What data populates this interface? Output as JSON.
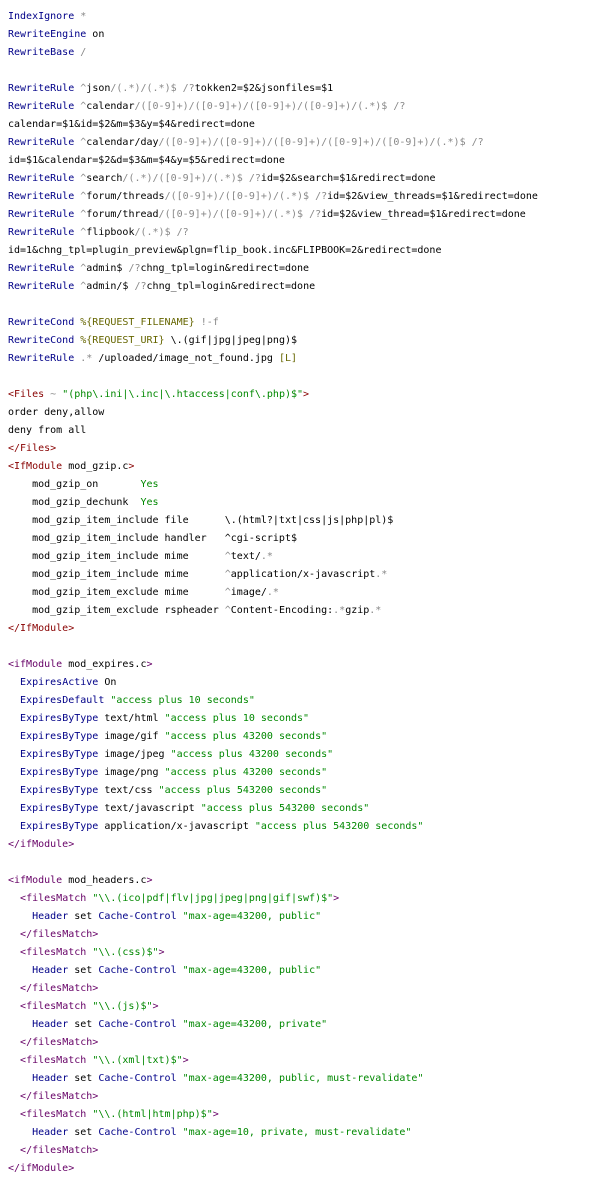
{
  "document": {
    "lines": [
      [
        [
          "k",
          "IndexIgnore"
        ],
        [
          "p",
          " "
        ],
        [
          "g",
          "*"
        ]
      ],
      [
        [
          "k",
          "RewriteEngine"
        ],
        [
          "p",
          " on"
        ]
      ],
      [
        [
          "k",
          "RewriteBase"
        ],
        [
          "p",
          " "
        ],
        [
          "g",
          "/"
        ]
      ],
      [],
      [
        [
          "k",
          "RewriteRule"
        ],
        [
          "p",
          " "
        ],
        [
          "g",
          "^"
        ],
        [
          "p",
          "json"
        ],
        [
          "g",
          "/(.*)/(.*)$"
        ],
        [
          "p",
          " "
        ],
        [
          "g",
          "/?"
        ],
        [
          "p",
          "tokken2=$2&jsonfiles=$1"
        ]
      ],
      [
        [
          "k",
          "RewriteRule"
        ],
        [
          "p",
          " "
        ],
        [
          "g",
          "^"
        ],
        [
          "p",
          "calendar"
        ],
        [
          "g",
          "/([0-9]+)/([0-9]+)/([0-9]+)/([0-9]+)/(.*)$"
        ],
        [
          "p",
          " "
        ],
        [
          "g",
          "/?"
        ]
      ],
      [
        [
          "p",
          "calendar=$1&id=$2&m=$3&y=$4&redirect=done"
        ]
      ],
      [
        [
          "k",
          "RewriteRule"
        ],
        [
          "p",
          " "
        ],
        [
          "g",
          "^"
        ],
        [
          "p",
          "calendar/day"
        ],
        [
          "g",
          "/([0-9]+)/([0-9]+)/([0-9]+)/([0-9]+)/([0-9]+)/(.*)$"
        ],
        [
          "p",
          " "
        ],
        [
          "g",
          "/?"
        ]
      ],
      [
        [
          "p",
          "id=$1&calendar=$2&d=$3&m=$4&y=$5&redirect=done"
        ]
      ],
      [
        [
          "k",
          "RewriteRule"
        ],
        [
          "p",
          " "
        ],
        [
          "g",
          "^"
        ],
        [
          "p",
          "search"
        ],
        [
          "g",
          "/(.*)/([0-9]+)/(.*)$"
        ],
        [
          "p",
          " "
        ],
        [
          "g",
          "/?"
        ],
        [
          "p",
          "id=$2&search=$1&redirect=done"
        ]
      ],
      [
        [
          "k",
          "RewriteRule"
        ],
        [
          "p",
          " "
        ],
        [
          "g",
          "^"
        ],
        [
          "p",
          "forum/threads"
        ],
        [
          "g",
          "/([0-9]+)/([0-9]+)/(.*)$"
        ],
        [
          "p",
          " "
        ],
        [
          "g",
          "/?"
        ],
        [
          "p",
          "id=$2&view_threads=$1&redirect=done"
        ]
      ],
      [
        [
          "k",
          "RewriteRule"
        ],
        [
          "p",
          " "
        ],
        [
          "g",
          "^"
        ],
        [
          "p",
          "forum/thread"
        ],
        [
          "g",
          "/([0-9]+)/([0-9]+)/(.*)$"
        ],
        [
          "p",
          " "
        ],
        [
          "g",
          "/?"
        ],
        [
          "p",
          "id=$2&view_thread=$1&redirect=done"
        ]
      ],
      [
        [
          "k",
          "RewriteRule"
        ],
        [
          "p",
          " "
        ],
        [
          "g",
          "^"
        ],
        [
          "p",
          "flipbook"
        ],
        [
          "g",
          "/(.*)$"
        ],
        [
          "p",
          " "
        ],
        [
          "g",
          "/?"
        ]
      ],
      [
        [
          "p",
          "id=1&chng_tpl=plugin_preview&plgn=flip_book.inc&FLIPBOOK=2&redirect=done"
        ]
      ],
      [
        [
          "k",
          "RewriteRule"
        ],
        [
          "p",
          " "
        ],
        [
          "g",
          "^"
        ],
        [
          "p",
          "admin$"
        ],
        [
          "p",
          " "
        ],
        [
          "g",
          "/?"
        ],
        [
          "p",
          "chng_tpl=login&redirect=done"
        ]
      ],
      [
        [
          "k",
          "RewriteRule"
        ],
        [
          "p",
          " "
        ],
        [
          "g",
          "^"
        ],
        [
          "p",
          "admin/$"
        ],
        [
          "p",
          " "
        ],
        [
          "g",
          "/?"
        ],
        [
          "p",
          "chng_tpl=login&redirect=done"
        ]
      ],
      [],
      [
        [
          "k",
          "RewriteCond"
        ],
        [
          "p",
          " "
        ],
        [
          "a",
          "%{REQUEST_FILENAME}"
        ],
        [
          "p",
          " "
        ],
        [
          "g",
          "!-f"
        ]
      ],
      [
        [
          "k",
          "RewriteCond"
        ],
        [
          "p",
          " "
        ],
        [
          "a",
          "%{REQUEST_URI}"
        ],
        [
          "p",
          " \\.(gif|jpg|jpeg|png)$"
        ]
      ],
      [
        [
          "k",
          "RewriteRule"
        ],
        [
          "p",
          " "
        ],
        [
          "g",
          ".*"
        ],
        [
          "p",
          " /uploaded/image_not_found.jpg "
        ],
        [
          "a",
          "[L]"
        ]
      ],
      [],
      [
        [
          "t",
          "<Files"
        ],
        [
          "p",
          " "
        ],
        [
          "g",
          "~"
        ],
        [
          "p",
          " "
        ],
        [
          "s",
          "\"(php\\.ini|\\.inc|\\.htaccess|conf\\.php)$\""
        ],
        [
          "t",
          ">"
        ]
      ],
      [
        [
          "p",
          "order deny,allow"
        ]
      ],
      [
        [
          "p",
          "deny from all"
        ]
      ],
      [
        [
          "t",
          "</Files>"
        ]
      ],
      [
        [
          "t",
          "<IfModule"
        ],
        [
          "p",
          " mod_gzip.c"
        ],
        [
          "t",
          ">"
        ]
      ],
      [
        [
          "p",
          "    mod_gzip_on       "
        ],
        [
          "s",
          "Yes"
        ]
      ],
      [
        [
          "p",
          "    mod_gzip_dechunk  "
        ],
        [
          "s",
          "Yes"
        ]
      ],
      [
        [
          "p",
          "    mod_gzip_item_include file      \\.(html?|txt|css|js|php|pl)$"
        ]
      ],
      [
        [
          "p",
          "    mod_gzip_item_include handler   ^cgi-script$"
        ]
      ],
      [
        [
          "p",
          "    mod_gzip_item_include mime      "
        ],
        [
          "g",
          "^"
        ],
        [
          "p",
          "text/"
        ],
        [
          "g",
          ".*"
        ]
      ],
      [
        [
          "p",
          "    mod_gzip_item_include mime      "
        ],
        [
          "g",
          "^"
        ],
        [
          "p",
          "application/x-javascript"
        ],
        [
          "g",
          ".*"
        ]
      ],
      [
        [
          "p",
          "    mod_gzip_item_exclude mime      "
        ],
        [
          "g",
          "^"
        ],
        [
          "p",
          "image/"
        ],
        [
          "g",
          ".*"
        ]
      ],
      [
        [
          "p",
          "    mod_gzip_item_exclude rspheader "
        ],
        [
          "g",
          "^"
        ],
        [
          "p",
          "Content-Encoding:"
        ],
        [
          "g",
          ".*"
        ],
        [
          "p",
          "gzip"
        ],
        [
          "g",
          ".*"
        ]
      ],
      [
        [
          "t",
          "</IfModule>"
        ]
      ],
      [],
      [
        [
          "tl",
          "<ifModule"
        ],
        [
          "p",
          " mod_expires.c"
        ],
        [
          "tl",
          ">"
        ]
      ],
      [
        [
          "p",
          "  "
        ],
        [
          "k",
          "ExpiresActive"
        ],
        [
          "p",
          " On"
        ]
      ],
      [
        [
          "p",
          "  "
        ],
        [
          "k",
          "ExpiresDefault"
        ],
        [
          "p",
          " "
        ],
        [
          "s",
          "\"access plus 10 seconds\""
        ]
      ],
      [
        [
          "p",
          "  "
        ],
        [
          "k",
          "ExpiresByType"
        ],
        [
          "p",
          " text/html "
        ],
        [
          "s",
          "\"access plus 10 seconds\""
        ]
      ],
      [
        [
          "p",
          "  "
        ],
        [
          "k",
          "ExpiresByType"
        ],
        [
          "p",
          " image/gif "
        ],
        [
          "s",
          "\"access plus 43200 seconds\""
        ]
      ],
      [
        [
          "p",
          "  "
        ],
        [
          "k",
          "ExpiresByType"
        ],
        [
          "p",
          " image/jpeg "
        ],
        [
          "s",
          "\"access plus 43200 seconds\""
        ]
      ],
      [
        [
          "p",
          "  "
        ],
        [
          "k",
          "ExpiresByType"
        ],
        [
          "p",
          " image/png "
        ],
        [
          "s",
          "\"access plus 43200 seconds\""
        ]
      ],
      [
        [
          "p",
          "  "
        ],
        [
          "k",
          "ExpiresByType"
        ],
        [
          "p",
          " text/css "
        ],
        [
          "s",
          "\"access plus 543200 seconds\""
        ]
      ],
      [
        [
          "p",
          "  "
        ],
        [
          "k",
          "ExpiresByType"
        ],
        [
          "p",
          " text/javascript "
        ],
        [
          "s",
          "\"access plus 543200 seconds\""
        ]
      ],
      [
        [
          "p",
          "  "
        ],
        [
          "k",
          "ExpiresByType"
        ],
        [
          "p",
          " application/x-javascript "
        ],
        [
          "s",
          "\"access plus 543200 seconds\""
        ]
      ],
      [
        [
          "tl",
          "</ifModule>"
        ]
      ],
      [],
      [
        [
          "tl",
          "<ifModule"
        ],
        [
          "p",
          " mod_headers.c"
        ],
        [
          "tl",
          ">"
        ]
      ],
      [
        [
          "p",
          "  "
        ],
        [
          "tl",
          "<filesMatch"
        ],
        [
          "p",
          " "
        ],
        [
          "s",
          "\"\\\\.(ico|pdf|flv|jpg|jpeg|png|gif|swf)$\""
        ],
        [
          "tl",
          ">"
        ]
      ],
      [
        [
          "p",
          "    "
        ],
        [
          "k",
          "Header"
        ],
        [
          "p",
          " set "
        ],
        [
          "k",
          "Cache-Control"
        ],
        [
          "p",
          " "
        ],
        [
          "s",
          "\"max-age=43200, public\""
        ]
      ],
      [
        [
          "p",
          "  "
        ],
        [
          "tl",
          "</filesMatch>"
        ]
      ],
      [
        [
          "p",
          "  "
        ],
        [
          "tl",
          "<filesMatch"
        ],
        [
          "p",
          " "
        ],
        [
          "s",
          "\"\\\\.(css)$\""
        ],
        [
          "tl",
          ">"
        ]
      ],
      [
        [
          "p",
          "    "
        ],
        [
          "k",
          "Header"
        ],
        [
          "p",
          " set "
        ],
        [
          "k",
          "Cache-Control"
        ],
        [
          "p",
          " "
        ],
        [
          "s",
          "\"max-age=43200, public\""
        ]
      ],
      [
        [
          "p",
          "  "
        ],
        [
          "tl",
          "</filesMatch>"
        ]
      ],
      [
        [
          "p",
          "  "
        ],
        [
          "tl",
          "<filesMatch"
        ],
        [
          "p",
          " "
        ],
        [
          "s",
          "\"\\\\.(js)$\""
        ],
        [
          "tl",
          ">"
        ]
      ],
      [
        [
          "p",
          "    "
        ],
        [
          "k",
          "Header"
        ],
        [
          "p",
          " set "
        ],
        [
          "k",
          "Cache-Control"
        ],
        [
          "p",
          " "
        ],
        [
          "s",
          "\"max-age=43200, private\""
        ]
      ],
      [
        [
          "p",
          "  "
        ],
        [
          "tl",
          "</filesMatch>"
        ]
      ],
      [
        [
          "p",
          "  "
        ],
        [
          "tl",
          "<filesMatch"
        ],
        [
          "p",
          " "
        ],
        [
          "s",
          "\"\\\\.(xml|txt)$\""
        ],
        [
          "tl",
          ">"
        ]
      ],
      [
        [
          "p",
          "    "
        ],
        [
          "k",
          "Header"
        ],
        [
          "p",
          " set "
        ],
        [
          "k",
          "Cache-Control"
        ],
        [
          "p",
          " "
        ],
        [
          "s",
          "\"max-age=43200, public, must-revalidate\""
        ]
      ],
      [
        [
          "p",
          "  "
        ],
        [
          "tl",
          "</filesMatch>"
        ]
      ],
      [
        [
          "p",
          "  "
        ],
        [
          "tl",
          "<filesMatch"
        ],
        [
          "p",
          " "
        ],
        [
          "s",
          "\"\\\\.(html|htm|php)$\""
        ],
        [
          "tl",
          ">"
        ]
      ],
      [
        [
          "p",
          "    "
        ],
        [
          "k",
          "Header"
        ],
        [
          "p",
          " set "
        ],
        [
          "k",
          "Cache-Control"
        ],
        [
          "p",
          " "
        ],
        [
          "s",
          "\"max-age=10, private, must-revalidate\""
        ]
      ],
      [
        [
          "p",
          "  "
        ],
        [
          "tl",
          "</filesMatch>"
        ]
      ],
      [
        [
          "tl",
          "</ifModule>"
        ]
      ]
    ]
  }
}
